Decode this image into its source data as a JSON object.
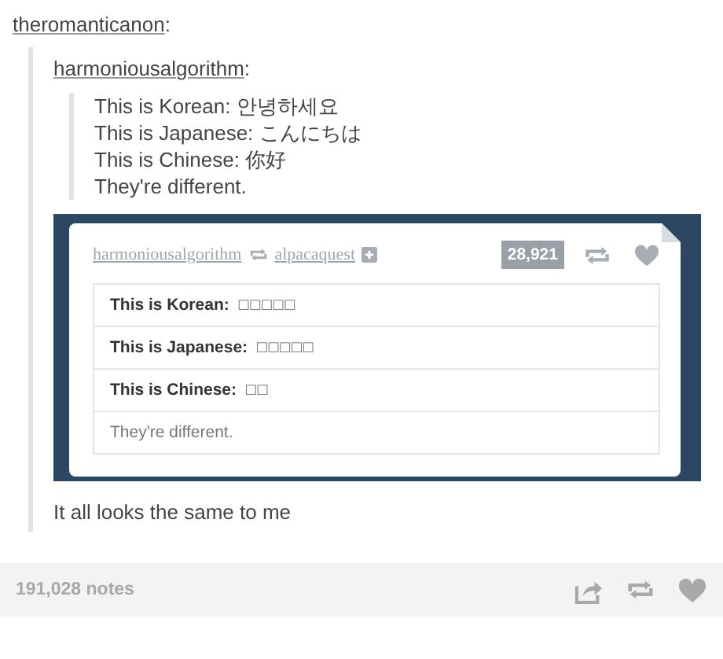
{
  "post": {
    "author": "theromanticanon",
    "author_suffix": ":",
    "quote": {
      "author": "harmoniousalgorithm",
      "author_suffix": ":",
      "lines": [
        "This is Korean: 안녕하세요",
        "This is Japanese: こんにちは",
        "This is Chinese: 你好",
        "They're different."
      ],
      "embedded_post": {
        "author": "harmoniousalgorithm",
        "reblogged_from": "alpacaquest",
        "note_count": "28,921",
        "rows": [
          {
            "kind": "labeled",
            "label": "This is Korean:",
            "value": "□□□□□"
          },
          {
            "kind": "labeled",
            "label": "This is Japanese:",
            "value": "□□□□□"
          },
          {
            "kind": "labeled",
            "label": "This is Chinese:",
            "value": "□□"
          },
          {
            "kind": "plain",
            "text": "They're different."
          }
        ]
      }
    },
    "comment": "It all looks the same to me"
  },
  "footer": {
    "notes": "191,028 notes"
  }
}
